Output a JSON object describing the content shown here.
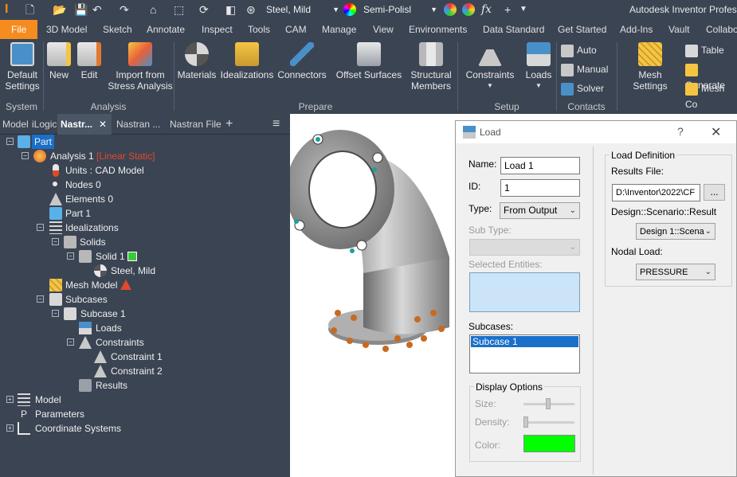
{
  "app": {
    "title": "Autodesk Inventor Profes",
    "logo_letter": "I"
  },
  "qat": {
    "material": "Steel, Mild",
    "appearance": "Semi-Polisl",
    "fx": "fx"
  },
  "tabs": [
    "File",
    "3D Model",
    "Sketch",
    "Annotate",
    "Inspect",
    "Tools",
    "CAM",
    "Manage",
    "View",
    "Environments",
    "Data Standard",
    "Get Started",
    "Add-Ins",
    "Vault",
    "Collabo"
  ],
  "ribbon": {
    "buttons": [
      "Default\nSettings",
      "New",
      "Edit",
      "Import from\nStress Analysis",
      "Materials",
      "Idealizations",
      "Connectors",
      "Offset Surfaces",
      "Structural\nMembers",
      "Constraints",
      "Loads",
      "Mesh Settings"
    ],
    "small": [
      "Auto",
      "Manual",
      "Solver",
      "Table",
      "Generate",
      "Mesh Co"
    ],
    "groups": [
      "System",
      "Analysis",
      "Prepare",
      "Setup",
      "Contacts"
    ]
  },
  "browser_tabs": [
    "Model",
    "iLogic",
    "Nastr...",
    "Nastran ...",
    "Nastran File"
  ],
  "tree": {
    "part": "Part",
    "analysis": "Analysis 1",
    "analysis_type": "[Linear Static]",
    "units": "Units : CAD Model",
    "nodes": "Nodes 0",
    "elements": "Elements 0",
    "part1": "Part 1",
    "idealizations": "Idealizations",
    "solids": "Solids",
    "solid1": "Solid 1",
    "steel": "Steel, Mild",
    "mesh": "Mesh Model",
    "subcases": "Subcases",
    "subcase1": "Subcase 1",
    "loads": "Loads",
    "constraints": "Constraints",
    "c1": "Constraint 1",
    "c2": "Constraint 2",
    "results": "Results",
    "model": "Model",
    "parameters": "Parameters",
    "coords": "Coordinate Systems"
  },
  "dialog": {
    "title": "Load",
    "help": "?",
    "close": "✕",
    "name_label": "Name:",
    "name_value": "Load 1",
    "id_label": "ID:",
    "id_value": "1",
    "type_label": "Type:",
    "type_value": "From Output",
    "subtype_label": "Sub Type:",
    "selected_label": "Selected Entities:",
    "subcases_label": "Subcases:",
    "subcase_item": "Subcase 1",
    "display_label": "Display Options",
    "size_label": "Size:",
    "density_label": "Density:",
    "color_label": "Color:",
    "color_value": "#00ff00",
    "loaddef_label": "Load Definition",
    "results_label": "Results File:",
    "results_value": "D:\\Inventor\\2022\\CF",
    "browse": "...",
    "dsr_label": "Design::Scenario::Result",
    "dsr_value": "Design 1::Scena",
    "nodal_label": "Nodal Load:",
    "nodal_value": "PRESSURE"
  },
  "colors": {
    "accent": "#f68b1f",
    "panel": "#3b4453",
    "highlight": "#1a6fc8",
    "warning": "#e04a2a"
  }
}
